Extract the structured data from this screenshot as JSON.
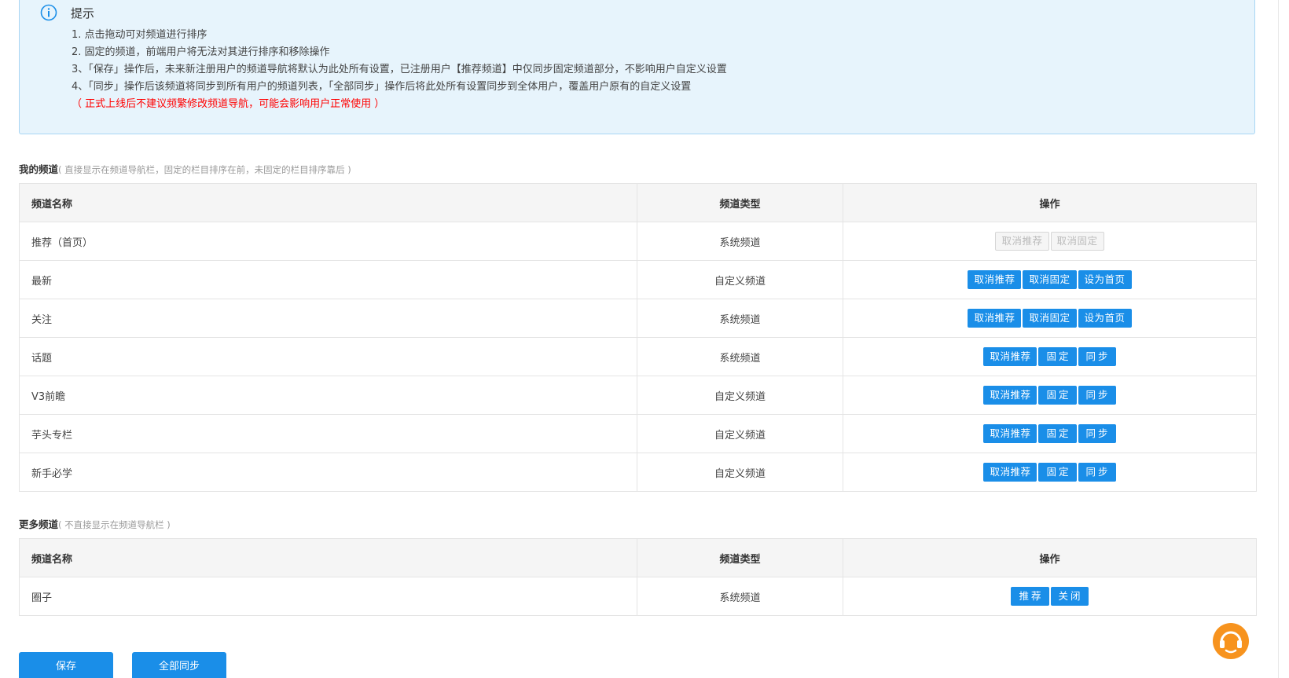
{
  "hint": {
    "title": "提示",
    "icon": "info-icon",
    "lines": [
      "1. 点击拖动可对频道进行排序",
      "2. 固定的频道，前端用户将无法对其进行排序和移除操作",
      "3、「保存」操作后，未来新注册用户的频道导航将默认为此处所有设置，已注册用户【推荐频道】中仅同步固定频道部分，不影响用户自定义设置",
      "4、「同步」操作后该频道将同步到所有用户的频道列表，「全部同步」操作后将此处所有设置同步到全体用户，覆盖用户原有的自定义设置"
    ],
    "warning": "（ 正式上线后不建议频繁修改频道导航，可能会影响用户正常使用 ）"
  },
  "my_channels": {
    "title": "我的频道",
    "subtitle": "( 直接显示在频道导航栏，固定的栏目排序在前，未固定的栏目排序靠后 )",
    "headers": [
      "频道名称",
      "频道类型",
      "操作"
    ],
    "rows": [
      {
        "name": "推荐（首页）",
        "type": "系统频道",
        "buttons": [
          {
            "label": "取消推荐",
            "disabled": true
          },
          {
            "label": "取消固定",
            "disabled": true
          }
        ]
      },
      {
        "name": "最新",
        "type": "自定义频道",
        "buttons": [
          {
            "label": "取消推荐"
          },
          {
            "label": "取消固定"
          },
          {
            "label": "设为首页"
          }
        ]
      },
      {
        "name": "关注",
        "type": "系统频道",
        "buttons": [
          {
            "label": "取消推荐"
          },
          {
            "label": "取消固定"
          },
          {
            "label": "设为首页"
          }
        ]
      },
      {
        "name": "话题",
        "type": "系统频道",
        "buttons": [
          {
            "label": "取消推荐"
          },
          {
            "label": "固定"
          },
          {
            "label": "同步"
          }
        ]
      },
      {
        "name": "V3前瞻",
        "type": "自定义频道",
        "buttons": [
          {
            "label": "取消推荐"
          },
          {
            "label": "固定"
          },
          {
            "label": "同步"
          }
        ]
      },
      {
        "name": "芋头专栏",
        "type": "自定义频道",
        "buttons": [
          {
            "label": "取消推荐"
          },
          {
            "label": "固定"
          },
          {
            "label": "同步"
          }
        ]
      },
      {
        "name": "新手必学",
        "type": "自定义频道",
        "buttons": [
          {
            "label": "取消推荐"
          },
          {
            "label": "固定"
          },
          {
            "label": "同步"
          }
        ]
      }
    ]
  },
  "more_channels": {
    "title": "更多频道",
    "subtitle": "( 不直接显示在频道导航栏 )",
    "headers": [
      "频道名称",
      "频道类型",
      "操作"
    ],
    "rows": [
      {
        "name": "圈子",
        "type": "系统频道",
        "buttons": [
          {
            "label": "推荐"
          },
          {
            "label": "关闭"
          }
        ]
      }
    ]
  },
  "footer": {
    "save_label": "保存",
    "sync_all_label": "全部同步"
  },
  "colors": {
    "accent": "#1a8ee8",
    "hint_bg": "#e7f4fc",
    "warning": "#ff0000",
    "support": "#f7931e"
  }
}
